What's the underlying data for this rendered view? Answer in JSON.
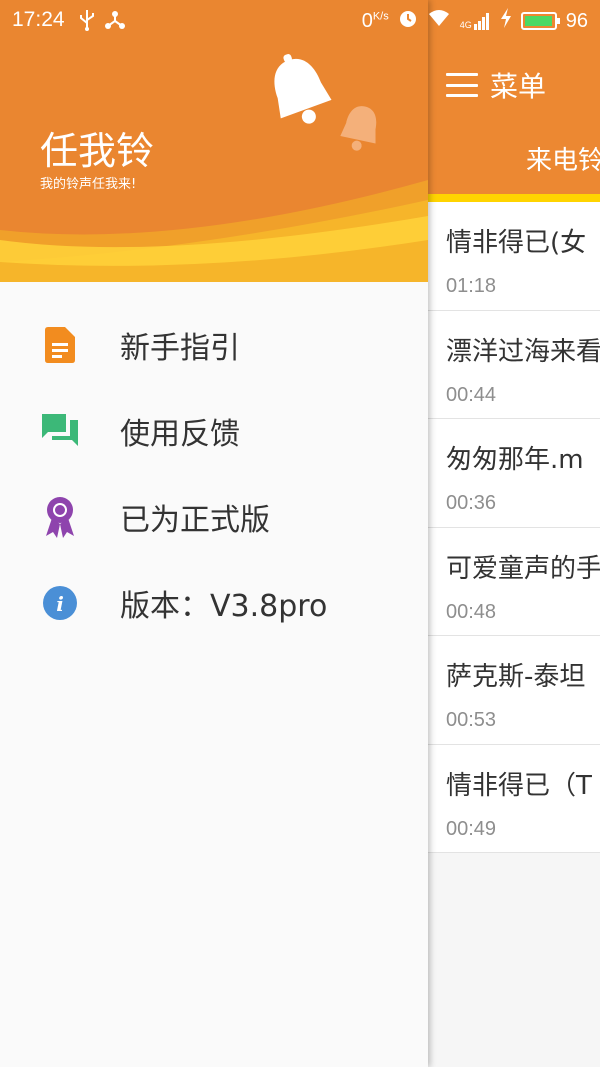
{
  "status_bar": {
    "time": "17:24",
    "net_speed": "0",
    "net_unit": "K/s",
    "network": "4G",
    "battery": "96"
  },
  "drawer": {
    "app_name": "任我铃",
    "slogan": "我的铃声任我来!",
    "items": [
      {
        "label": "新手指引",
        "icon": "document-icon",
        "color": "#f28c1f"
      },
      {
        "label": "使用反馈",
        "icon": "chat-icon",
        "color": "#3cb878"
      },
      {
        "label": "已为正式版",
        "icon": "badge-icon",
        "color": "#8e44ad"
      },
      {
        "label": "版本：V3.8pro",
        "icon": "info-icon",
        "color": "#4a8fd6"
      }
    ]
  },
  "main": {
    "menu_label": "菜单",
    "tab_label": "来电铃声",
    "songs": [
      {
        "title": "情非得已(女",
        "duration": "01:18"
      },
      {
        "title": "漂洋过海来看",
        "duration": "00:44"
      },
      {
        "title": "匆匆那年.m",
        "duration": "00:36"
      },
      {
        "title": "可爱童声的手",
        "duration": "00:48"
      },
      {
        "title": "萨克斯-泰坦",
        "duration": "00:53"
      },
      {
        "title": "情非得已（T",
        "duration": "00:49"
      }
    ]
  },
  "colors": {
    "accent": "#ec8832",
    "indicator": "#ffd400"
  }
}
